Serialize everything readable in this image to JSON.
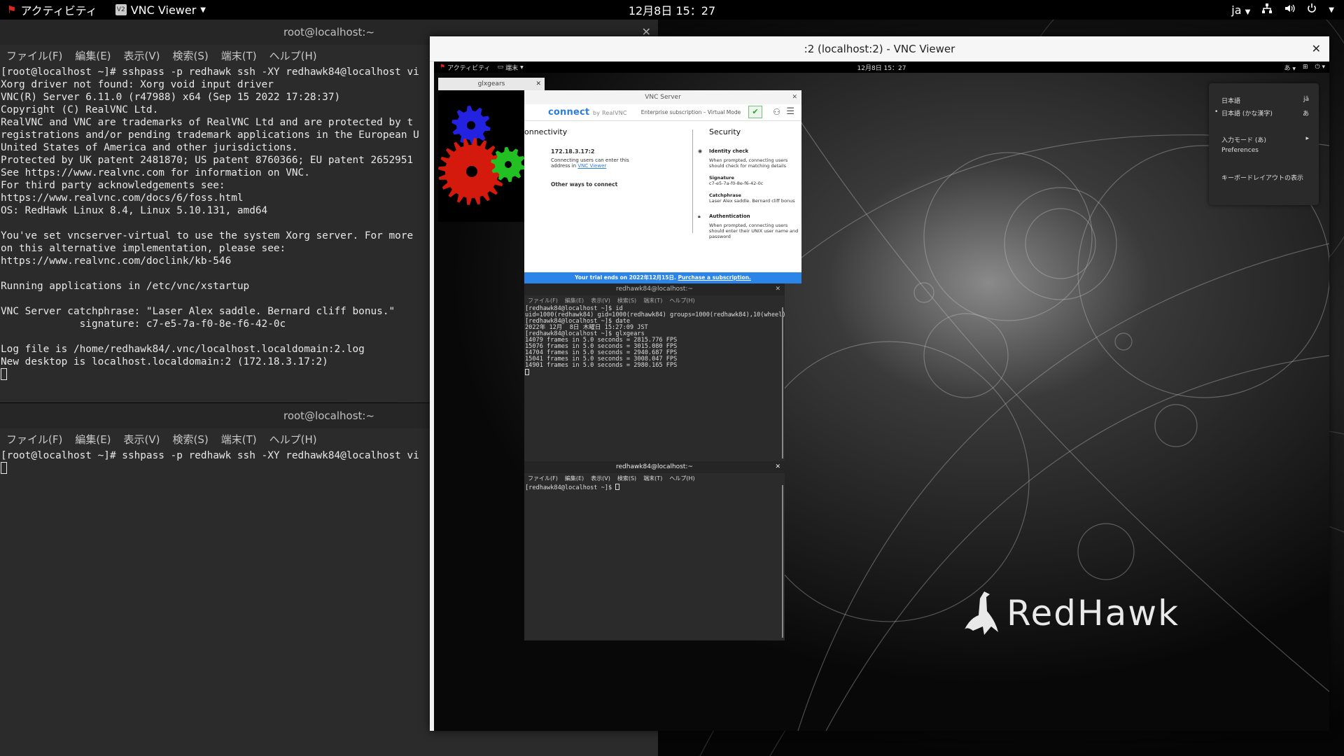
{
  "topbar": {
    "activities": "アクティビティ",
    "app_name": "VNC Viewer",
    "app_icon_text": "V2",
    "clock": "12月8日  15：27",
    "lang": "ja"
  },
  "host_terminal_1": {
    "title": "root@localhost:~",
    "menu": [
      "ファイル(F)",
      "編集(E)",
      "表示(V)",
      "検索(S)",
      "端末(T)",
      "ヘルプ(H)"
    ],
    "lines": [
      "[root@localhost ~]# sshpass -p redhawk ssh -XY redhawk84@localhost vi",
      "Xorg driver not found: Xorg void input driver",
      "VNC(R) Server 6.11.0 (r47988) x64 (Sep 15 2022 17:28:37)",
      "Copyright (C) RealVNC Ltd.",
      "RealVNC and VNC are trademarks of RealVNC Ltd and are protected by t",
      "registrations and/or pending trademark applications in the European U",
      "United States of America and other jurisdictions.",
      "Protected by UK patent 2481870; US patent 8760366; EU patent 2652951",
      "See https://www.realvnc.com for information on VNC.",
      "For third party acknowledgements see:",
      "https://www.realvnc.com/docs/6/foss.html",
      "OS: RedHawk Linux 8.4, Linux 5.10.131, amd64",
      "",
      "You've set vncserver-virtual to use the system Xorg server. For more",
      "on this alternative implementation, please see:",
      "https://www.realvnc.com/doclink/kb-546",
      "",
      "Running applications in /etc/vnc/xstartup",
      "",
      "VNC Server catchphrase: \"Laser Alex saddle. Bernard cliff bonus.\"",
      "             signature: c7-e5-7a-f0-8e-f6-42-0c",
      "",
      "Log file is /home/redhawk84/.vnc/localhost.localdomain:2.log",
      "New desktop is localhost.localdomain:2 (172.18.3.17:2)"
    ]
  },
  "host_terminal_2": {
    "title": "root@localhost:~",
    "menu": [
      "ファイル(F)",
      "編集(E)",
      "表示(V)",
      "検索(S)",
      "端末(T)",
      "ヘルプ(H)"
    ],
    "lines": [
      "[root@localhost ~]# sshpass -p redhawk ssh -XY redhawk84@localhost vi"
    ]
  },
  "vnc_viewer": {
    "title": ":2 (localhost:2) - VNC Viewer",
    "remote_topbar": {
      "activities": "アクティビティ",
      "app": "端末",
      "clock": "12月8日  15：27",
      "ime": "あ"
    },
    "ime_popup": {
      "items": [
        {
          "label": "日本語",
          "hint": "jā"
        },
        {
          "label": "日本語 (かな漢字)",
          "hint": "あ"
        },
        {
          "label": "入力モード (あ)",
          "hint": "▸"
        },
        {
          "label": "Preferences",
          "hint": ""
        },
        {
          "label": "キーボードレイアウトの表示",
          "hint": ""
        }
      ]
    },
    "glxgears": {
      "title": "glxgears"
    },
    "vnc_server": {
      "title": "VNC Server",
      "brand": "connect",
      "brand_by": "by RealVNC",
      "subscription": "Enterprise subscription – Virtual Mode",
      "connectivity_heading": "onnectivity",
      "address": "172.18.3.17:2",
      "address_note": "Connecting users can enter this address in",
      "address_link": "VNC Viewer",
      "other_ways": "Other ways to connect",
      "security_heading": "Security",
      "identity_check": "Identity check",
      "identity_note": "When prompted, connecting users should check for matching details",
      "signature_label": "Signature",
      "signature_value": "c7-e5-7a-f0-8e-f6-42-0c",
      "catchphrase_label": "Catchphrase",
      "catchphrase_value": "Laser Alex saddle. Bernard cliff bonus",
      "auth_label": "Authentication",
      "auth_note": "When prompted, connecting users should enter their UNIX user name and password",
      "trial_text": "Your trial ends on 2022年12月15日.",
      "trial_link": "Purchase a subscription."
    },
    "remote_terminal_1": {
      "title": "redhawk84@localhost:~",
      "menu": [
        "ファイル(F)",
        "編集(E)",
        "表示(V)",
        "検索(S)",
        "端末(T)",
        "ヘルプ(H)"
      ],
      "lines": [
        "[redhawk84@localhost ~]$ id",
        "uid=1000(redhawk84) gid=1000(redhawk84) groups=1000(redhawk84),10(wheel)",
        "[redhawk84@localhost ~]$ date",
        "2022年 12月  8日 木曜日 15:27:09 JST",
        "[redhawk84@localhost ~]$ glxgears",
        "14079 frames in 5.0 seconds = 2815.776 FPS",
        "15076 frames in 5.0 seconds = 3015.080 FPS",
        "14704 frames in 5.0 seconds = 2940.687 FPS",
        "15041 frames in 5.0 seconds = 3008.047 FPS",
        "14901 frames in 5.0 seconds = 2980.165 FPS"
      ]
    },
    "remote_terminal_2": {
      "title": "redhawk84@localhost:~",
      "menu": [
        "ファイル(F)",
        "編集(E)",
        "表示(V)",
        "検索(S)",
        "端末(T)",
        "ヘルプ(H)"
      ],
      "lines": [
        "[redhawk84@localhost ~]$ "
      ]
    },
    "logo_text": "RedHawk"
  },
  "colors": {
    "terminal_bg": "#2b2b2b",
    "topbar_bg": "#000000",
    "vnc_accent": "#2b84e8",
    "gear_red": "#d41a0c",
    "gear_green": "#22c022",
    "gear_blue": "#2222e0"
  }
}
